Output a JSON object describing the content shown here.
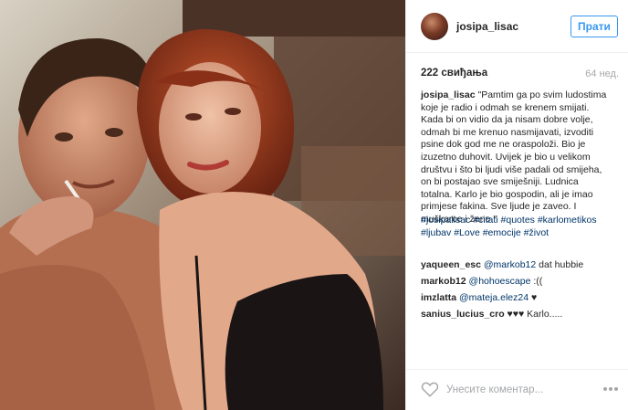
{
  "post": {
    "username": "josipa_lisac",
    "follow_label": "Прати",
    "likes": "222 свиђања",
    "time": "64 нед.",
    "caption_username": "josipa_lisac",
    "caption_lines": [
      "\"Pamtim ga po svim ludostima",
      "koje je radio i odmah se krenem smijati.",
      "Kada bi on vidio da ja nisam dobre volje,",
      "odmah bi me krenuo nasmijavati, izvoditi",
      "psine dok god me ne oraspoloži. Bio je",
      "izuzetno duhovit. Uvijek je bio u velikom",
      "društvu i što bi ljudi više padali od smijeha,",
      "on bi postajao sve smiješniji. Ludnica",
      "totalna. Karlo je bio gospodin, ali je imao",
      "primjese fakina. Sve ljude je zaveo. I",
      "muškarce i žene.\""
    ],
    "hashtags_line1": "#josipalisac #citati #quotes #karlometikos",
    "hashtags_line2": "#ljubav #Love #emocije #život"
  },
  "comments": [
    {
      "user": "yaqueen_esc",
      "mention": "@markob12",
      "text": " dat hubbie"
    },
    {
      "user": "markob12",
      "mention": "@hohoescape",
      "text": " :(("
    },
    {
      "user": "imzlatta",
      "mention": "@mateja.elez24",
      "text": " ♥"
    },
    {
      "user": "sanius_lucius_cro",
      "mention": "",
      "text": "♥♥♥ Karlo....."
    }
  ],
  "footer": {
    "comment_placeholder": "Унесите коментар...",
    "heart_icon": "heart-outline-icon",
    "more_icon": "more-options-icon"
  },
  "colors": {
    "accent": "#3897f0",
    "hashtag": "#003569",
    "muted": "#a5a7aa",
    "text": "#262626"
  }
}
